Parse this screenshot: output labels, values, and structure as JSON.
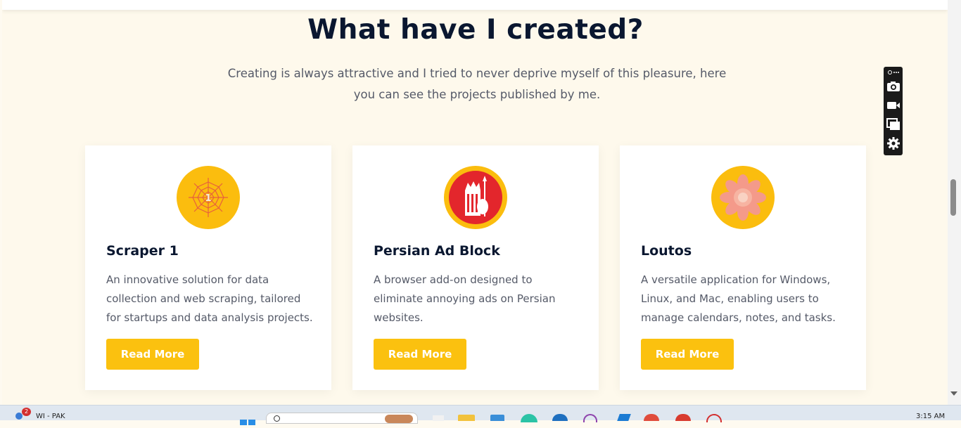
{
  "section": {
    "heading": "What have I created?",
    "subtitle_line1": "Creating is always attractive and I tried to never deprive myself of this pleasure, here",
    "subtitle_line2": "you can see the projects published by me."
  },
  "projects": [
    {
      "icon": "spider-web-icon",
      "title": "Scraper 1",
      "description": "An innovative solution for data collection and web scraping, tailored for startups and data analysis projects.",
      "button": "Read More"
    },
    {
      "icon": "persian-soldier-icon",
      "title": "Persian Ad Block",
      "description": "A browser add-on designed to eliminate annoying ads on Persian websites.",
      "button": "Read More"
    },
    {
      "icon": "lotus-flower-icon",
      "title": "Loutos",
      "description": "A versatile application for Windows, Linux, and Mac, enabling users to manage calendars, notes, and tasks.",
      "button": "Read More"
    }
  ],
  "taskbar": {
    "weather_label": "WI - PAK",
    "notification_count": "2",
    "clock": "3:15 AM"
  },
  "colors": {
    "accent": "#fbc10f",
    "heading": "#0a1730",
    "background": "#fef9ec"
  }
}
